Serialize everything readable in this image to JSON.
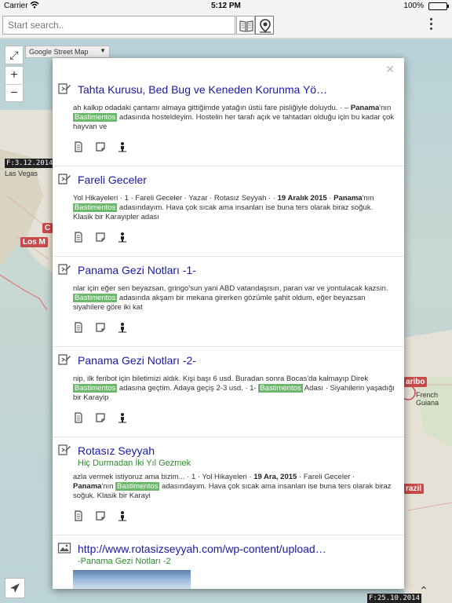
{
  "status_bar": {
    "carrier": "Carrier",
    "time": "5:12 PM",
    "battery": "100%"
  },
  "toolbar": {
    "search_placeholder": "Start search.."
  },
  "map": {
    "layer_select": "Google Street Map",
    "date_left_top": "F:3.12.2014",
    "date_right_bottom": "F:25.10.2014",
    "label_las_vegas": "Las Vegas",
    "label_los_angeles": "Los M",
    "label_c": "C",
    "label_maribo": "aribo",
    "label_french_guiana": "French\nGuiana",
    "label_brazil": "razil",
    "colors": {
      "water": "#b8d2d8",
      "land": "#e6e1d6",
      "badge": "#c94a4a"
    }
  },
  "results": [
    {
      "title": "Tahta Kurusu, Bed Bug ve Keneden Korunma Yö…",
      "snippet": [
        "ah kalkıp odadaki çantamı almaya gittiğimde yatağın üstü fare pisliğiyle doluydu. · – ",
        {
          "b": "Panama"
        },
        "'nın ",
        {
          "hl": "Bastimentos"
        },
        " adasında hosteldeyim. Hostelin her tarafı açık ve tahtadan olduğu için bu kadar çok hayvan ve"
      ]
    },
    {
      "title": "Fareli Geceler",
      "snippet": [
        "Yol Hikayeleri · 1 · Fareli Geceler · Yazar · Rotasız Seyyah · · ",
        {
          "b": "19 Aralık 2015"
        },
        " · ",
        {
          "b": "Panama"
        },
        "'nın ",
        {
          "hl": "Bastimentos"
        },
        " adasındayım. Hava çok sıcak ama insanları ise buna ters olarak biraz soğuk. Klasik bir Karayipler adası"
      ]
    },
    {
      "title": "Panama Gezi Notları -1-",
      "snippet": [
        "nlar için eğer sen beyazsan, gringo'sun yani ABD vatandaşısın, paran var ve yontulacak kazsın. ",
        {
          "hl": "Bastimentos"
        },
        " adasında akşam bir mekana girerken gözümle şahit oldum, eğer beyazsan siyahilere göre iki kat"
      ]
    },
    {
      "title": "Panama Gezi Notları -2-",
      "snippet": [
        "nip, ilk feribot için biletimizi aldık. Kişi başı 6 usd. Buradan sonra Bocas'da kalmayıp Direk ",
        {
          "hl": "Bastimentos"
        },
        " adasına geçtim. Adaya geçiş 2-3 usd. · 1- ",
        {
          "hl": "Bastimentos"
        },
        " Adası · Siyahilerin yaşadığı bir Karayip"
      ]
    },
    {
      "title": "Rotasız Seyyah",
      "subtitle": "Hiç Durmadan İki Yıl Gezmek",
      "snippet": [
        "azla vermek istiyoruz ama bizim... · 1 · Yol Hikayeleri · ",
        {
          "b": "19 Ara, 2015"
        },
        " · Fareli Geceler · ",
        {
          "b": "Panama"
        },
        "'nın ",
        {
          "hl": "Bastimentos"
        },
        " adasındayım. Hava çok sıcak ama insanları ise buna ters olarak biraz soğuk. Klasik bir Karayi"
      ]
    },
    {
      "title": "http://www.rotasizseyyah.com/wp-content/upload…",
      "subtitle": "-Panama Gezi Notları -2"
    }
  ]
}
